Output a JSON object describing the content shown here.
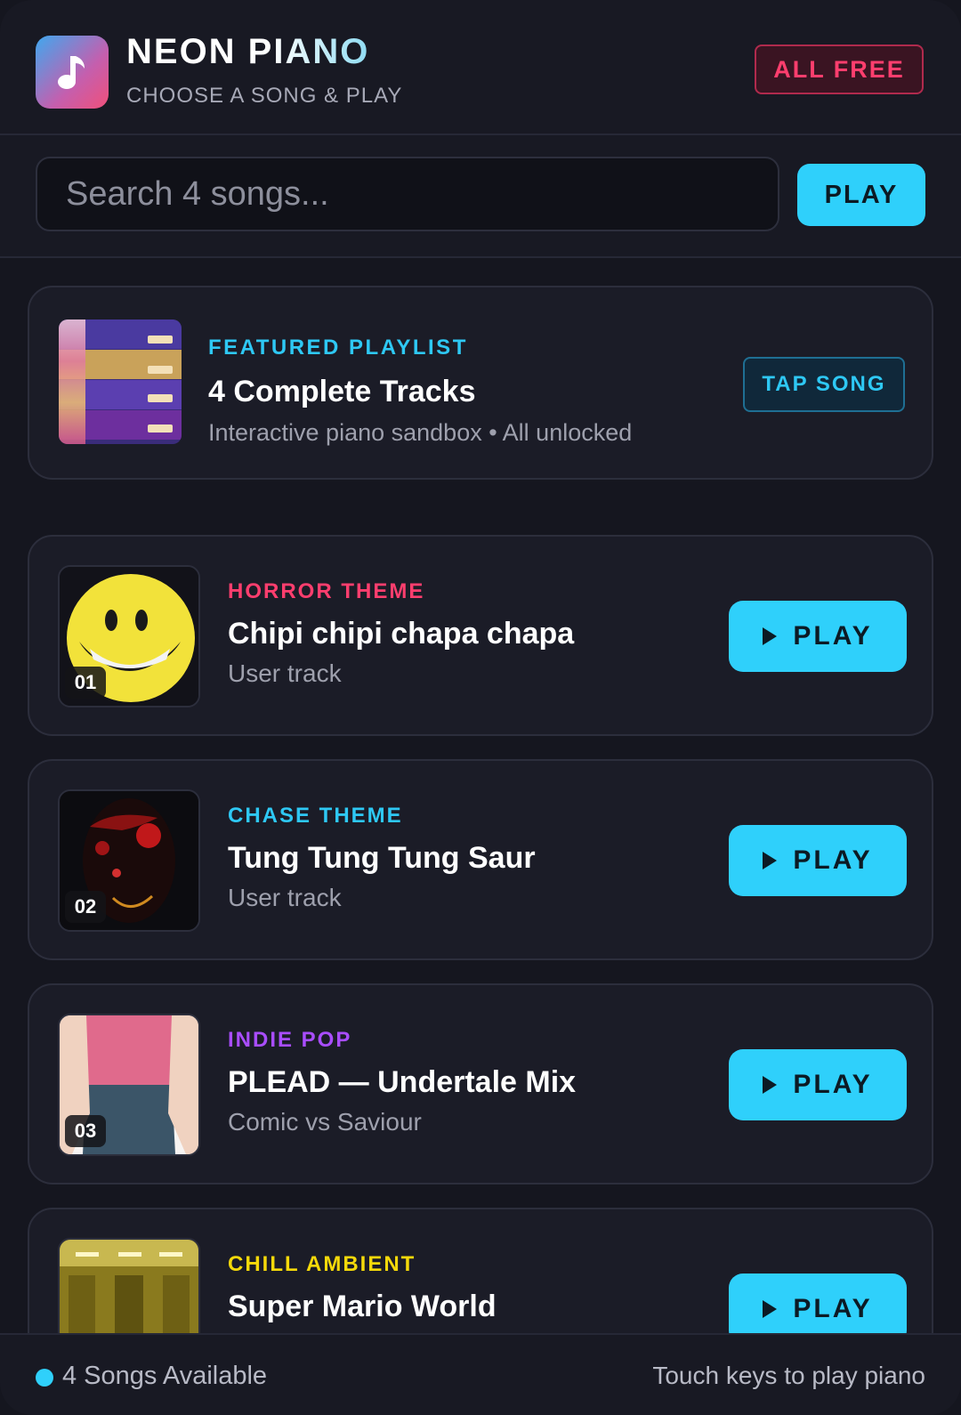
{
  "header": {
    "title": "NEON PIANO",
    "subtitle": "CHOOSE A SONG & PLAY",
    "badge": "ALL FREE",
    "app_icon": "music-note-icon"
  },
  "search": {
    "placeholder": "Search 4 songs...",
    "value": "",
    "button_label": "PLAY"
  },
  "featured": {
    "label": "FEATURED PLAYLIST",
    "title": "4 Complete Tracks",
    "description": "Interactive piano sandbox • All unlocked",
    "button_label": "TAP SONG"
  },
  "songs": [
    {
      "number": "01",
      "tag": "HORROR THEME",
      "tag_color": "#ff3e6e",
      "title": "Chipi chipi chapa chapa",
      "artist": "User track",
      "button_label": "PLAY",
      "thumb": "smiley-face"
    },
    {
      "number": "02",
      "tag": "CHASE THEME",
      "tag_color": "#2ec8f4",
      "title": "Tung Tung Tung Saur",
      "artist": "User track",
      "button_label": "PLAY",
      "thumb": "dark-creature"
    },
    {
      "number": "03",
      "tag": "INDIE POP",
      "tag_color": "#a94dff",
      "title": "PLEAD — Undertale Mix",
      "artist": "Comic vs Saviour",
      "button_label": "PLAY",
      "thumb": "figure-torso"
    },
    {
      "number": "",
      "tag": "CHILL AMBIENT",
      "tag_color": "#f5d90a",
      "title": "Super Mario World",
      "artist": "",
      "button_label": "PLAY",
      "thumb": "yellow-rooms"
    }
  ],
  "footer": {
    "songs_available": "4 Songs Available",
    "hint": "Touch keys to play piano"
  },
  "colors": {
    "accent": "#2fd0fb",
    "background": "#15161f",
    "card": "#1b1c27",
    "danger": "#ff3e6e"
  }
}
